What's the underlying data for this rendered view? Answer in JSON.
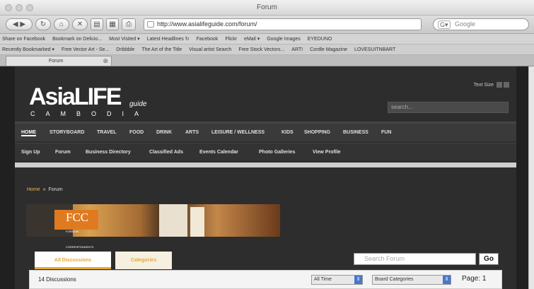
{
  "browser": {
    "window_title": "Forum",
    "url": "http://www.asialifeguide.com/forum/",
    "search_placeholder": "Google",
    "bookmarks_row1": [
      "Share on Facebook",
      "Bookmark on Delicio...",
      "Most Visited ▾",
      "Latest Headlines ↻",
      "Facebook",
      "Flickr",
      "eMail ▾",
      "Google Images",
      "EYEDUNO"
    ],
    "bookmarks_row2": [
      "Recently Bookmarked ▾",
      "Free Vector Art - Se...",
      "Dribbble",
      "The Art of the Title",
      "Visual artist Search",
      "Free Stock Vectors...",
      "ARTI",
      "Cordle Magazine",
      "LOVESUITNBART"
    ],
    "tab_title": "Forum"
  },
  "site": {
    "logo_main": "AsiaLIFE",
    "logo_guide": "guide",
    "logo_country": "CAMBODIA",
    "text_size_label": "Text Size",
    "search_placeholder": "search...",
    "main_nav": [
      "HOME",
      "STORYBOARD",
      "TRAVEL",
      "FOOD",
      "DRINK",
      "ARTS",
      "LEISURE / WELLNESS",
      "KIDS",
      "SHOPPING",
      "BUSINESS",
      "FUN"
    ],
    "sub_nav": [
      "Sign Up",
      "Forum",
      "Business Directory",
      "Classified Ads",
      "Events Calendar",
      "Photo Galleries",
      "View Profile"
    ],
    "breadcrumb": {
      "home": "Home",
      "sep": "»",
      "current": "Forum"
    },
    "banner_text": "FCC",
    "banner_subtext": "FOREIGN CORRESPONDENTS CLUB"
  },
  "forum": {
    "tab_discussions": "All Discussions",
    "tab_categories": "Categories",
    "search_placeholder": "Search Forum",
    "go_label": "Go",
    "count": "14 Discussions",
    "filter_time": "All Time",
    "filter_category": "Board Categories",
    "page": "Page: 1"
  },
  "colors": {
    "accent": "#e8a830",
    "page_bg": "#2d2d2d",
    "nav_text": "#e0e0e0"
  }
}
